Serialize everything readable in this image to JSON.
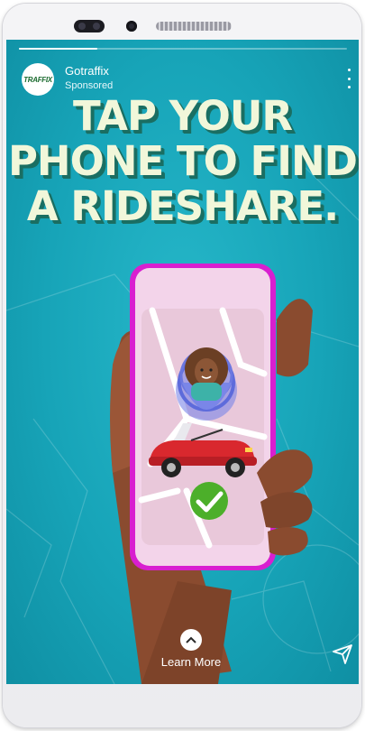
{
  "ad": {
    "brand_name": "Gotraffix",
    "sponsored_label": "Sponsored",
    "logo_text": "TRAFFIX",
    "headline_lines": [
      "TAP YOUR",
      "PHONE TO FIND",
      "A RIDESHARE."
    ],
    "cta_label": "Learn More",
    "story_progress_fraction": 0.24
  },
  "icons": {
    "more": "vertical-ellipsis-icon",
    "cta": "chevron-up-icon",
    "share": "paper-plane-icon",
    "check": "checkmark-icon"
  },
  "colors": {
    "background_teal": "#17a4b8",
    "headline_text": "#f1f7da",
    "phone_frame": "#d81fd0",
    "car_red": "#d9282e",
    "check_green": "#4caf2a"
  }
}
